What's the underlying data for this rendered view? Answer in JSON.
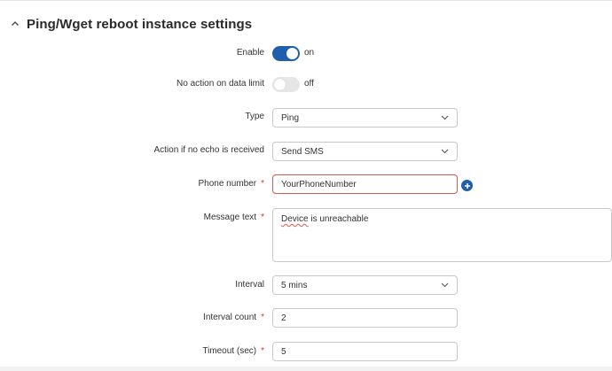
{
  "section": {
    "title": "Ping/Wget reboot instance settings"
  },
  "enable": {
    "label": "Enable",
    "state_text": "on",
    "checked": true
  },
  "no_action": {
    "label": "No action on data limit",
    "state_text": "off",
    "checked": false
  },
  "type": {
    "label": "Type",
    "value": "Ping"
  },
  "action": {
    "label": "Action if no echo is received",
    "value": "Send SMS"
  },
  "phone": {
    "label": "Phone number",
    "required": "*",
    "value": "YourPhoneNumber"
  },
  "message": {
    "label": "Message text",
    "required": "*",
    "value_word1": "Device",
    "value_rest": " is unreachable"
  },
  "interval": {
    "label": "Interval",
    "value": "5 mins"
  },
  "interval_count": {
    "label": "Interval count",
    "required": "*",
    "value": "2"
  },
  "timeout": {
    "label": "Timeout (sec)",
    "required": "*",
    "value": "5"
  },
  "colors": {
    "accent": "#1f5fad",
    "required": "#e0312f",
    "error_border": "#e2554f"
  },
  "icons": {
    "chevron": "chevron-up-icon",
    "dropdown": "chevron-down-icon",
    "add": "plus-circle-icon"
  }
}
